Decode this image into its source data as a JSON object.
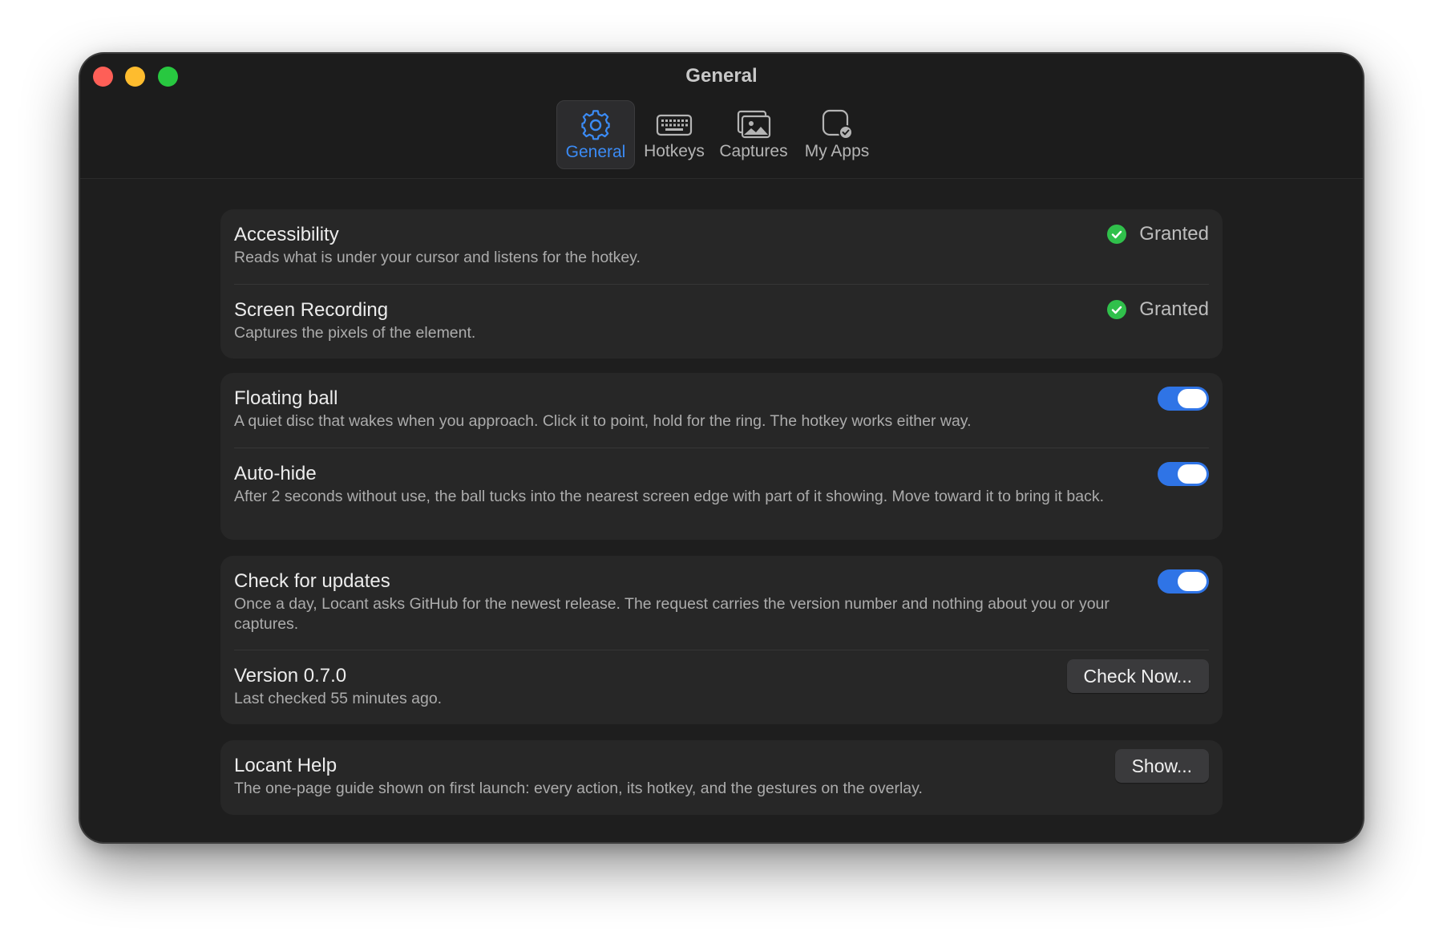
{
  "window": {
    "title": "General"
  },
  "tabs": [
    {
      "label": "General",
      "icon": "gear-icon",
      "active": true
    },
    {
      "label": "Hotkeys",
      "icon": "keyboard-icon",
      "active": false
    },
    {
      "label": "Captures",
      "icon": "photos-icon",
      "active": false
    },
    {
      "label": "My Apps",
      "icon": "app-check-icon",
      "active": false
    }
  ],
  "permissions": {
    "accessibility": {
      "title": "Accessibility",
      "description": "Reads what is under your cursor and listens for the hotkey.",
      "status": "Granted"
    },
    "screen_recording": {
      "title": "Screen Recording",
      "description": "Captures the pixels of the element.",
      "status": "Granted"
    }
  },
  "ball": {
    "floating": {
      "title": "Floating ball",
      "description": "A quiet disc that wakes when you approach. Click it to point, hold for the ring. The hotkey works either way.",
      "enabled": true
    },
    "autohide": {
      "title": "Auto-hide",
      "description": "After 2 seconds without use, the ball tucks into the nearest screen edge with part of it showing. Move toward it to bring it back.",
      "enabled": true
    }
  },
  "updates": {
    "check": {
      "title": "Check for updates",
      "description": "Once a day, Locant asks GitHub for the newest release. The request carries the version number and nothing about you or your captures.",
      "enabled": true
    },
    "version": {
      "title": "Version 0.7.0",
      "description": "Last checked 55 minutes ago.",
      "button": "Check Now..."
    }
  },
  "help": {
    "title": "Locant Help",
    "description": "The one-page guide shown on first launch: every action, its hotkey, and the gestures on the overlay.",
    "button": "Show..."
  },
  "colors": {
    "accent": "#2f74e6",
    "active_tab": "#3b8bf5",
    "granted": "#30c04b",
    "close": "#fe5f57",
    "minimize": "#febc2e",
    "maximize": "#28c840"
  }
}
